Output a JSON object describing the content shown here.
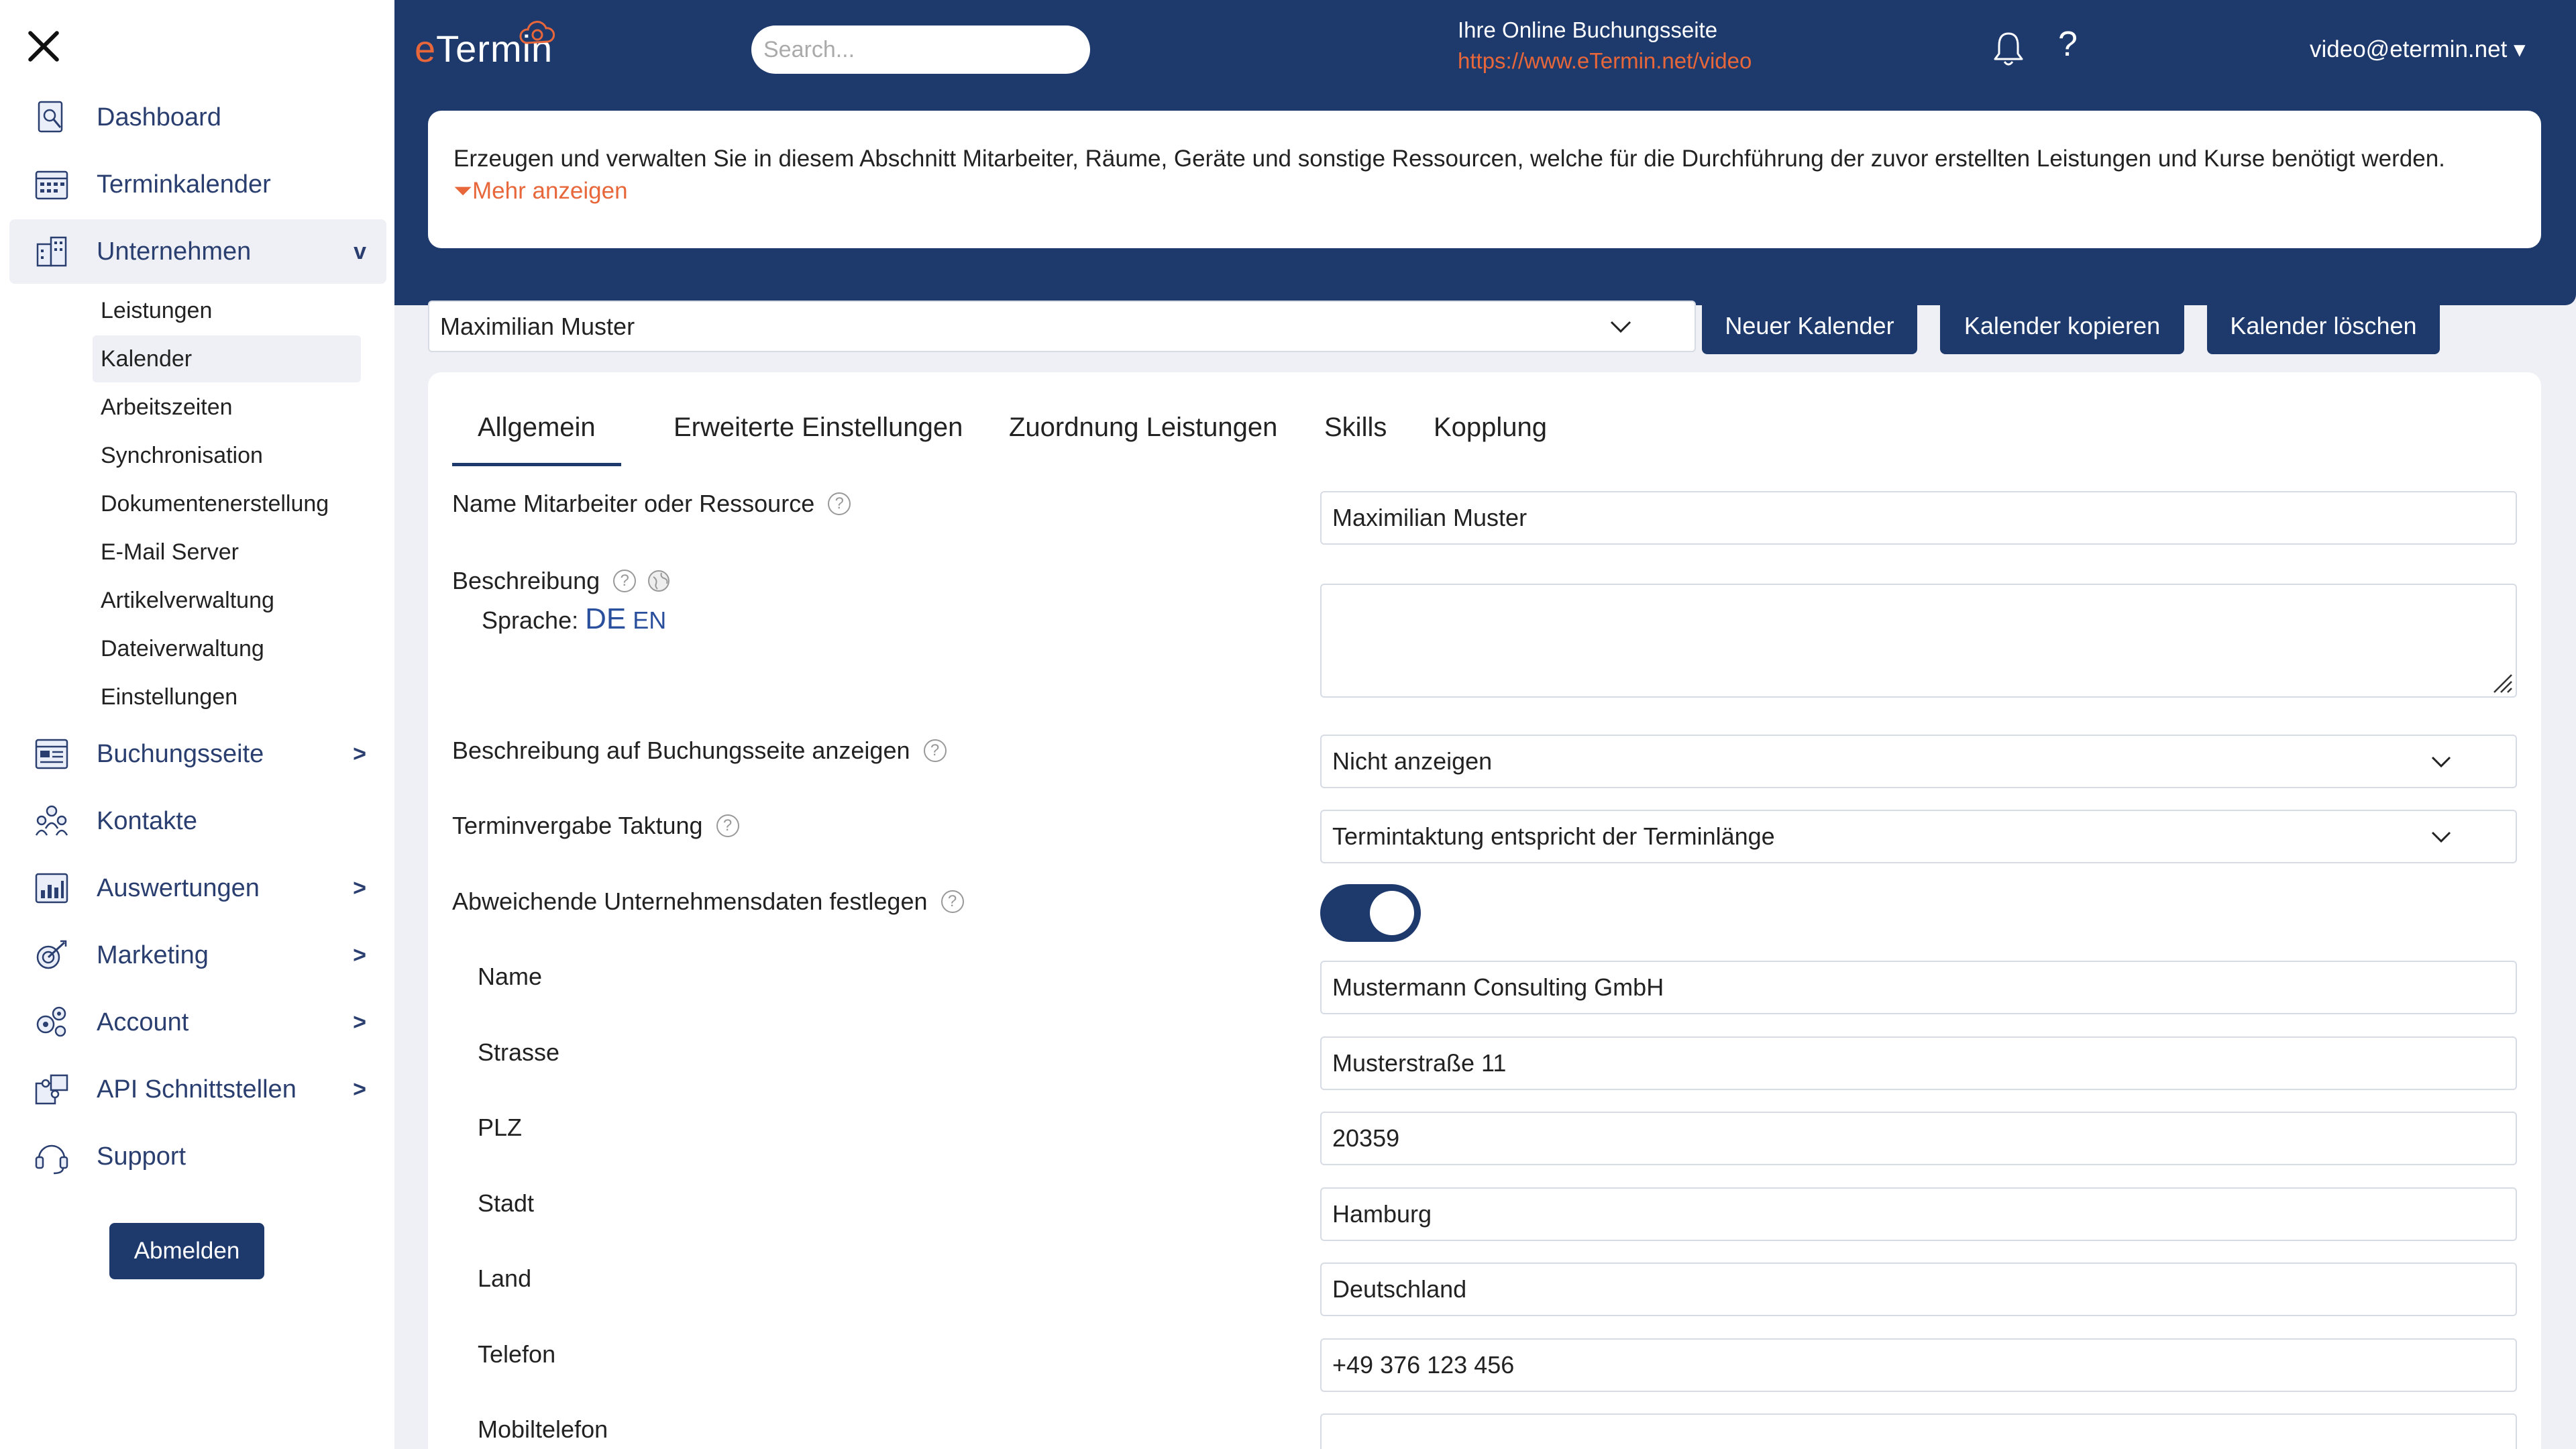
{
  "sidebar": {
    "items": [
      {
        "label": "Dashboard",
        "chevron": ""
      },
      {
        "label": "Terminkalender",
        "chevron": ""
      },
      {
        "label": "Unternehmen",
        "chevron": "v"
      },
      {
        "label": "Buchungsseite",
        "chevron": ">"
      },
      {
        "label": "Kontakte",
        "chevron": ""
      },
      {
        "label": "Auswertungen",
        "chevron": ">"
      },
      {
        "label": "Marketing",
        "chevron": ">"
      },
      {
        "label": "Account",
        "chevron": ">"
      },
      {
        "label": "API Schnittstellen",
        "chevron": ">"
      },
      {
        "label": "Support",
        "chevron": ""
      }
    ],
    "subitems": [
      "Leistungen",
      "Kalender",
      "Arbeitszeiten",
      "Synchronisation",
      "Dokumentenerstellung",
      "E-Mail Server",
      "Artikelverwaltung",
      "Dateiverwaltung",
      "Einstellungen"
    ],
    "logout_label": "Abmelden"
  },
  "header": {
    "logo_first": "e",
    "logo_rest": "Termin",
    "search_placeholder": "Search...",
    "booking_title": "Ihre Online Buchungsseite",
    "booking_url": "https://www.eTermin.net/video",
    "help_label": "?",
    "user": "video@etermin.net ▾"
  },
  "info": {
    "text": "Erzeugen und verwalten Sie in diesem Abschnitt Mitarbeiter, Räume, Geräte und sonstige Ressourcen, welche für die Durchführung der zuvor erstellten Leistungen und Kurse benötigt werden.",
    "more_label": "Mehr anzeigen"
  },
  "calendar": {
    "selected": "Maximilian Muster",
    "new_label": "Neuer Kalender",
    "copy_label": "Kalender kopieren",
    "delete_label": "Kalender löschen"
  },
  "tabs": [
    "Allgemein",
    "Erweiterte Einstellungen",
    "Zuordnung Leistungen",
    "Skills",
    "Kopplung"
  ],
  "form": {
    "name_label": "Name Mitarbeiter oder Ressource",
    "name_value": "Maximilian Muster",
    "desc_label": "Beschreibung",
    "lang_label": "Sprache:",
    "lang_de": "DE",
    "lang_en": "EN",
    "desc_show_label": "Beschreibung auf Buchungsseite anzeigen",
    "desc_show_value": "Nicht anzeigen",
    "takt_label": "Terminvergabe Taktung",
    "takt_value": "Termintaktung entspricht der Terminlänge",
    "company_label": "Abweichende Unternehmensdaten festlegen",
    "company_toggle_on": true,
    "company_name_label": "Name",
    "company_name_value": "Mustermann Consulting GmbH",
    "street_label": "Strasse",
    "street_value": "Musterstraße 11",
    "zip_label": "PLZ",
    "zip_value": "20359",
    "city_label": "Stadt",
    "city_value": "Hamburg",
    "country_label": "Land",
    "country_value": "Deutschland",
    "phone_label": "Telefon",
    "phone_value": "+49 376 123 456",
    "mobile_label": "Mobiltelefon",
    "mobile_value": ""
  },
  "colors": {
    "primary": "#1e3a6d",
    "accent": "#e8673a",
    "background": "#eef0f5"
  }
}
